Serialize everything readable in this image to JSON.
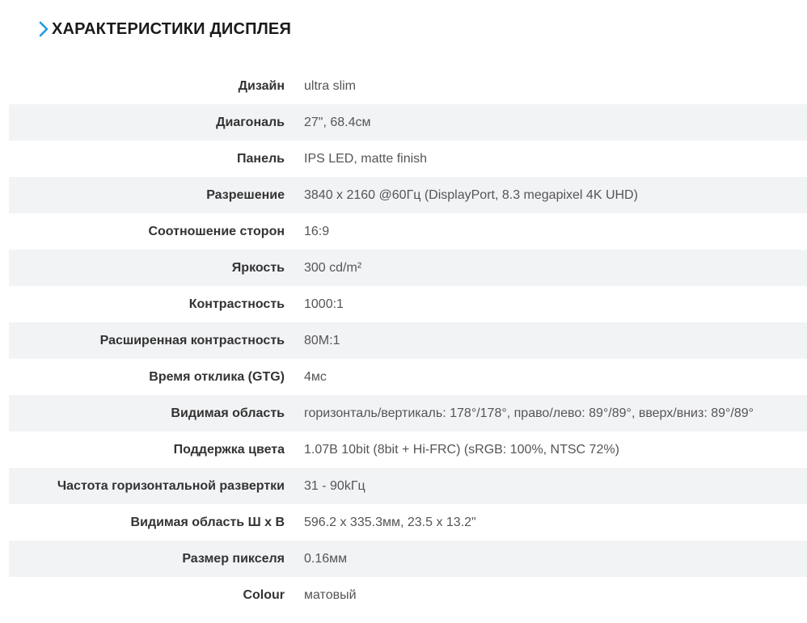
{
  "section": {
    "title": "ХАРАКТЕРИСТИКИ ДИСПЛЕЯ",
    "icon": "chevron-right-icon",
    "accent_color": "#1e9be0"
  },
  "specs": [
    {
      "label": "Дизайн",
      "value": "ultra slim"
    },
    {
      "label": "Диагональ",
      "value": "27\", 68.4см"
    },
    {
      "label": "Панель",
      "value": "IPS LED, matte finish"
    },
    {
      "label": "Разрешение",
      "value": "3840 x 2160 @60Гц (DisplayPort, 8.3 megapixel 4K UHD)"
    },
    {
      "label": "Соотношение сторон",
      "value": "16:9"
    },
    {
      "label": "Яркость",
      "value": "300 cd/m²"
    },
    {
      "label": "Контрастность",
      "value": "1000:1"
    },
    {
      "label": "Расширенная контрастность",
      "value": "80M:1"
    },
    {
      "label": "Время отклика (GTG)",
      "value": "4мс"
    },
    {
      "label": "Видимая область",
      "value": "горизонталь/вертикаль: 178°/178°, право/лево: 89°/89°, вверх/вниз: 89°/89°"
    },
    {
      "label": "Поддержка цвета",
      "value": "1.07B 10bit (8bit + Hi-FRC) (sRGB: 100%, NTSC 72%)"
    },
    {
      "label": "Частота горизонтальной развертки",
      "value": "31 - 90kГц"
    },
    {
      "label": "Видимая область Ш x В",
      "value": "596.2 x 335.3мм, 23.5 x 13.2\""
    },
    {
      "label": "Размер пикселя",
      "value": "0.16мм"
    },
    {
      "label": "Colour",
      "value": "матовый"
    }
  ]
}
